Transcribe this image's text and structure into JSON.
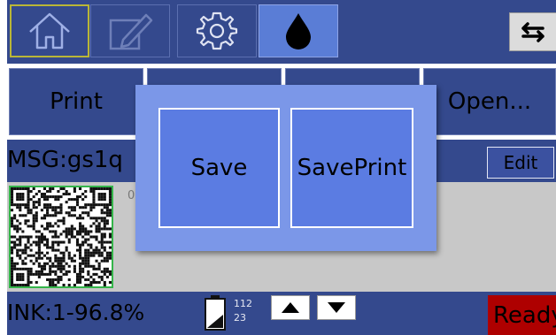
{
  "toolbar": {
    "icons": [
      "home-icon",
      "edit-icon",
      "gear-icon",
      "ink-drop-icon",
      "swap-icon"
    ],
    "colors": {
      "bar": "#34498d",
      "active_border": "#b9b637",
      "active_ink": "#5a7dd6"
    }
  },
  "function_buttons": [
    {
      "label": "Print"
    },
    {
      "label": ""
    },
    {
      "label": ""
    },
    {
      "label": "Open..."
    }
  ],
  "message": {
    "text": "MSG:gs1q",
    "edit_label": "Edit"
  },
  "preview": {
    "index_text": "0"
  },
  "status": {
    "ink": "INK:1-96.8%",
    "count_top": "112",
    "count_bottom": "23",
    "ready": "Ready",
    "ready_color": "#ae0000"
  },
  "dialog": {
    "save_label": "Save",
    "saveprint_label": "SavePrint"
  }
}
